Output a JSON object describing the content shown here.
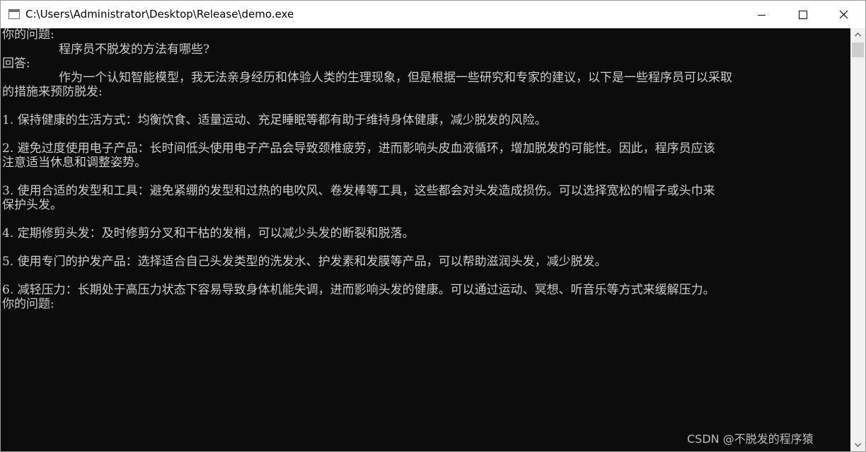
{
  "window": {
    "title": "C:\\Users\\Administrator\\Desktop\\Release\\demo.exe"
  },
  "console": {
    "lines": [
      "你的问题:",
      "程序员不脱发的方法有哪些?",
      "回答:",
      "作为一个认知智能模型，我无法亲身经历和体验人类的生理现象，但是根据一些研究和专家的建议，以下是一些程序员可以采取",
      "的措施来预防脱发:",
      "1. 保持健康的生活方式：均衡饮食、适量运动、充足睡眠等都有助于维持身体健康，减少脱发的风险。",
      "2. 避免过度使用电子产品：长时间低头使用电子产品会导致颈椎疲劳，进而影响头皮血液循环，增加脱发的可能性。因此，程序员应该",
      "注意适当休息和调整姿势。",
      "3. 使用合适的发型和工具：避免紧绷的发型和过热的电吹风、卷发棒等工具，这些都会对头发造成损伤。可以选择宽松的帽子或头巾来",
      "保护头发。",
      "4. 定期修剪头发：及时修剪分叉和干枯的发梢，可以减少头发的断裂和脱落。",
      "5. 使用专门的护发产品：选择适合自己头发类型的洗发水、护发素和发膜等产品，可以帮助滋润头发，减少脱发。",
      "6. 减轻压力：长期处于高压力状态下容易导致身体机能失调，进而影响头发的健康。可以通过运动、冥想、听音乐等方式来缓解压力。",
      "你的问题:"
    ]
  },
  "watermark": "CSDN @不脱发的程序猿",
  "icons": {
    "app": "console-app-icon",
    "minimize": "minimize-icon",
    "maximize": "maximize-icon",
    "close": "close-icon",
    "scroll_up": "scroll-up-arrow-icon",
    "scroll_down": "scroll-down-arrow-icon"
  },
  "colors": {
    "console_bg": "#0c0c0c",
    "console_text": "#cccccc",
    "titlebar_bg": "#ffffff",
    "scrollbar_bg": "#f0f0f0"
  }
}
